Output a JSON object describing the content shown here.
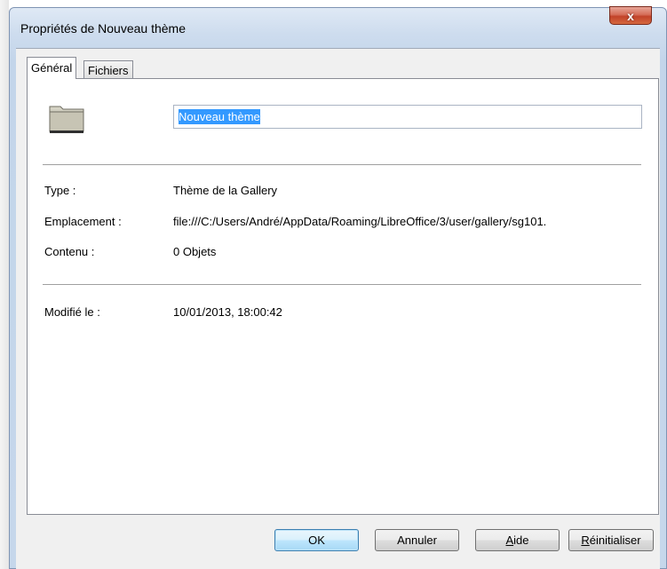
{
  "window": {
    "title": "Propriétés de Nouveau thème",
    "close_label": "x"
  },
  "tabs": [
    {
      "label": "Général",
      "active": true
    },
    {
      "label": "Fichiers",
      "active": false
    }
  ],
  "general": {
    "icon": "folder-icon",
    "name_value": "Nouveau thème",
    "type_label": "Type :",
    "type_value": "Thème de la Gallery",
    "location_label": "Emplacement :",
    "location_value": "file:///C:/Users/André/AppData/Roaming/LibreOffice/3/user/gallery/sg101.",
    "content_label": "Contenu :",
    "content_value": "0 Objets",
    "modified_label": "Modifié le :",
    "modified_value": "10/01/2013, 18:00:42"
  },
  "buttons": {
    "ok": "OK",
    "cancel": "Annuler",
    "help_first": "A",
    "help_rest": "ide",
    "reset_first": "R",
    "reset_rest": "éinitialiser"
  },
  "colors": {
    "selection": "#3399ff",
    "close_button": "#c2422a",
    "frame": "#c6d7eb"
  }
}
